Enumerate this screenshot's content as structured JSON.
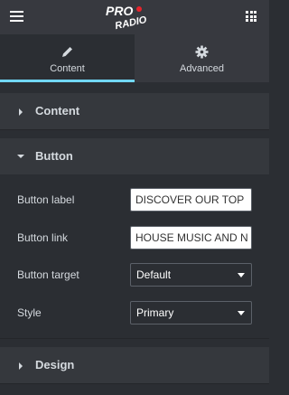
{
  "brand": {
    "logo_line1": "PRO",
    "logo_line2": "RADIO",
    "logo_accent": "#e8232c"
  },
  "topbar": {
    "menu_icon": "hamburger-icon",
    "apps_icon": "grid-icon"
  },
  "tabs": [
    {
      "label": "Content",
      "icon": "pencil-icon",
      "active": true
    },
    {
      "label": "Advanced",
      "icon": "gear-icon",
      "active": false
    }
  ],
  "sections": {
    "content": {
      "title": "Content",
      "expanded": false
    },
    "button": {
      "title": "Button",
      "expanded": true
    },
    "design": {
      "title": "Design",
      "expanded": false
    }
  },
  "button_controls": {
    "label": {
      "label": "Button label",
      "value": "DISCOVER OUR TOP"
    },
    "link": {
      "label": "Button link",
      "value": "HOUSE MUSIC AND N"
    },
    "target": {
      "label": "Button target",
      "value": "Default"
    },
    "style": {
      "label": "Style",
      "value": "Primary"
    }
  },
  "colors": {
    "accent": "#71d7f7",
    "panel_bg": "#2b2e33",
    "header_bg": "#37393f"
  }
}
